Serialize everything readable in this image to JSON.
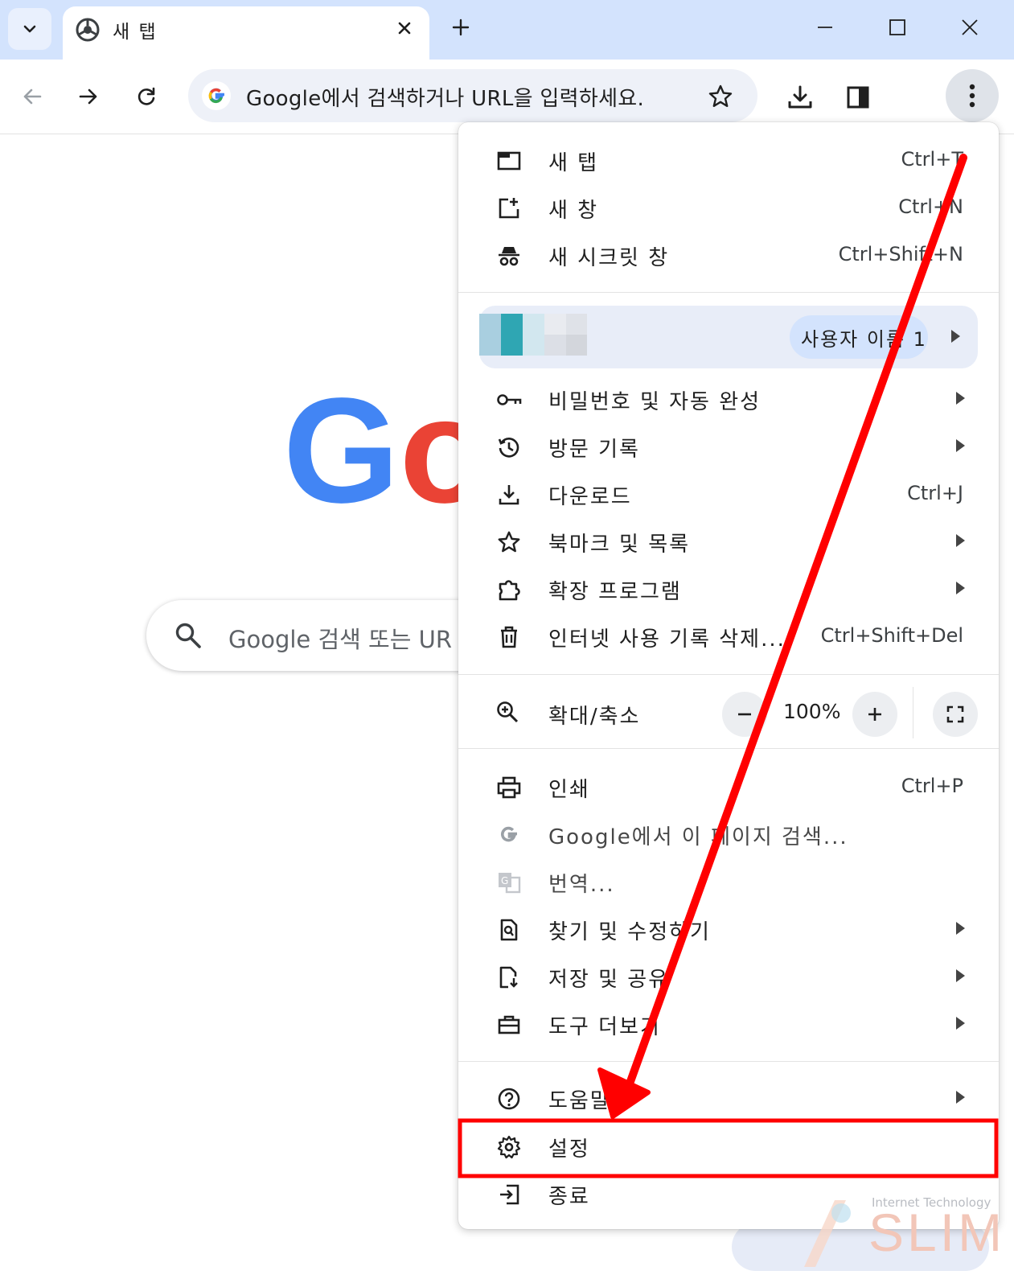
{
  "window": {
    "tab_title": "새 탭",
    "omnibox_placeholder": "Google에서 검색하거나 URL을 입력하세요."
  },
  "page": {
    "logo_text": "Google",
    "search_placeholder": "Google 검색 또는 UR"
  },
  "menu": {
    "group1": [
      {
        "icon": "new-tab-icon",
        "label": "새 탭",
        "shortcut": "Ctrl+T"
      },
      {
        "icon": "new-window-icon",
        "label": "새 창",
        "shortcut": "Ctrl+N"
      },
      {
        "icon": "incognito-icon",
        "label": "새 시크릿 창",
        "shortcut": "Ctrl+Shift+N"
      }
    ],
    "profile": {
      "name": "사용자 이름 1"
    },
    "group2": [
      {
        "icon": "key-icon",
        "label": "비밀번호 및 자동 완성",
        "shortcut": ""
      },
      {
        "icon": "history-icon",
        "label": "방문 기록",
        "shortcut": ""
      },
      {
        "icon": "download-icon",
        "label": "다운로드",
        "shortcut": "Ctrl+J"
      },
      {
        "icon": "star-icon",
        "label": "북마크 및 목록",
        "shortcut": ""
      },
      {
        "icon": "extension-icon",
        "label": "확장 프로그램",
        "shortcut": ""
      },
      {
        "icon": "trash-icon",
        "label": "인터넷 사용 기록 삭제...",
        "shortcut": "Ctrl+Shift+Del"
      }
    ],
    "zoom": {
      "label": "확대/축소",
      "value": "100%"
    },
    "group3": [
      {
        "icon": "print-icon",
        "label": "인쇄",
        "shortcut": "Ctrl+P"
      },
      {
        "icon": "google-g-icon",
        "label": "Google에서 이 페이지 검색...",
        "shortcut": ""
      },
      {
        "icon": "translate-icon",
        "label": "번역...",
        "shortcut": ""
      },
      {
        "icon": "find-edit-icon",
        "label": "찾기 및 수정하기",
        "shortcut": ""
      },
      {
        "icon": "save-share-icon",
        "label": "저장 및 공유",
        "shortcut": ""
      },
      {
        "icon": "toolbox-icon",
        "label": "도구 더보기",
        "shortcut": ""
      }
    ],
    "group4": [
      {
        "icon": "help-icon",
        "label": "도움말",
        "shortcut": ""
      },
      {
        "icon": "gear-icon",
        "label": "설정",
        "shortcut": ""
      },
      {
        "icon": "exit-icon",
        "label": "종료",
        "shortcut": ""
      }
    ]
  },
  "annotation": {
    "highlight_color": "#ff0000"
  },
  "watermark": {
    "small": "Internet Technology",
    "big": "SLIM"
  }
}
